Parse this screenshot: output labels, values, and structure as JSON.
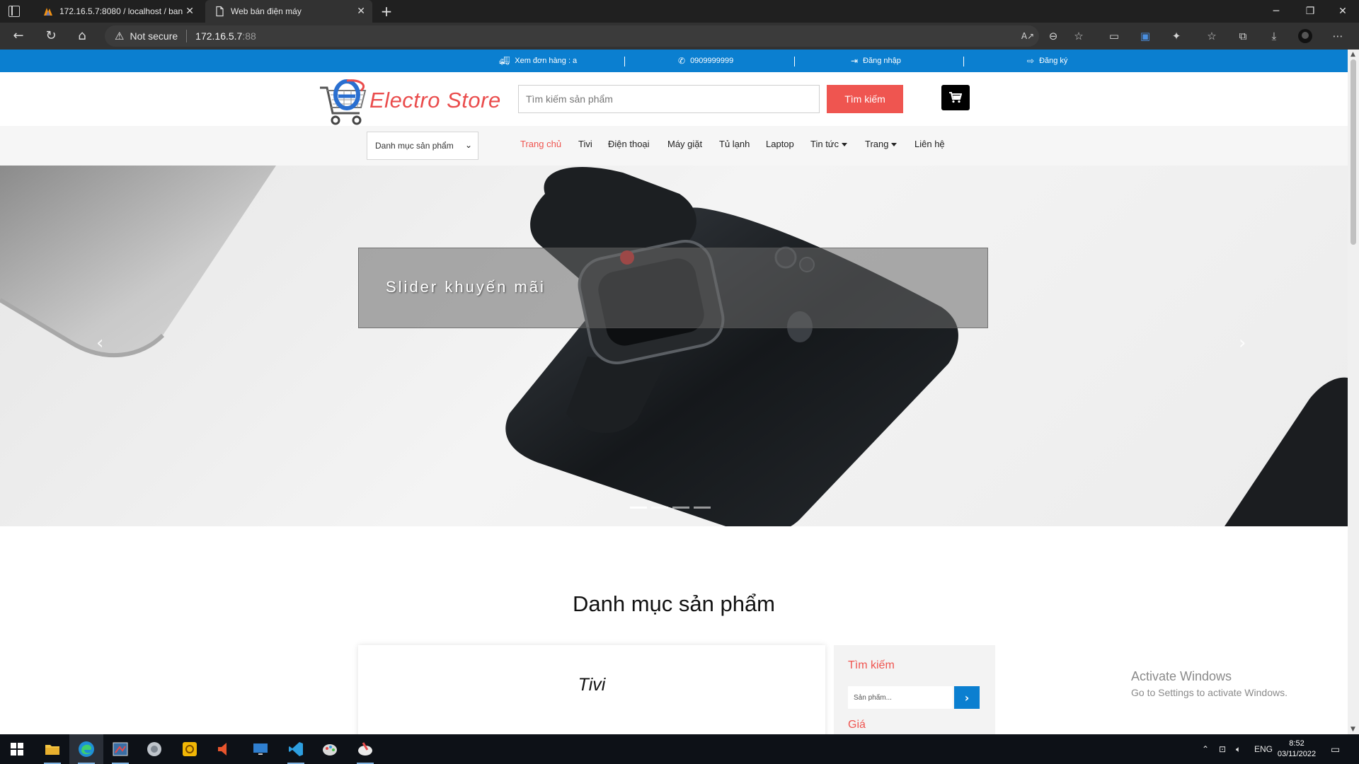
{
  "browser": {
    "tabs": [
      {
        "title": "172.16.5.7:8080 / localhost / ban",
        "active": false,
        "icon": "phpmyadmin-icon"
      },
      {
        "title": "Web bán điện máy",
        "active": true,
        "icon": "page-icon"
      }
    ],
    "security_label": "Not secure",
    "url_host": "172.16.5.7",
    "url_port": ":88"
  },
  "site": {
    "topbar": {
      "orders": "Xem đơn hàng : a",
      "phone": "0909999999",
      "login": "Đăng nhập",
      "register": "Đăng ký"
    },
    "logo_text": "Electro Store",
    "search": {
      "placeholder": "Tìm kiếm sản phẩm",
      "button": "Tìm kiếm"
    },
    "category_select": "Danh mục sản phẩm",
    "nav": {
      "home": "Trang chủ",
      "tv": "Tivi",
      "phone": "Điện thoại",
      "washer": "Máy giặt",
      "fridge": "Tủ lạnh",
      "laptop": "Laptop",
      "news": "Tin tức",
      "pages": "Trang",
      "contact": "Liên hệ"
    },
    "slider": {
      "caption": "Slider khuyến mãi",
      "slides": 4,
      "active_slide": 1
    },
    "section_title": "Danh mục sản phẩm",
    "category_card_title": "Tivi",
    "sidebar": {
      "search_title": "Tìm kiếm",
      "search_placeholder": "Sản phẩm...",
      "price_title": "Giá"
    },
    "colors": {
      "topbar": "#0b7fd0",
      "accent": "#ef5550",
      "logo": "#ea4c4c"
    }
  },
  "os": {
    "watermark_line1": "Activate Windows",
    "watermark_line2": "Go to Settings to activate Windows.",
    "language": "ENG",
    "time": "8:52",
    "date": "03/11/2022"
  }
}
